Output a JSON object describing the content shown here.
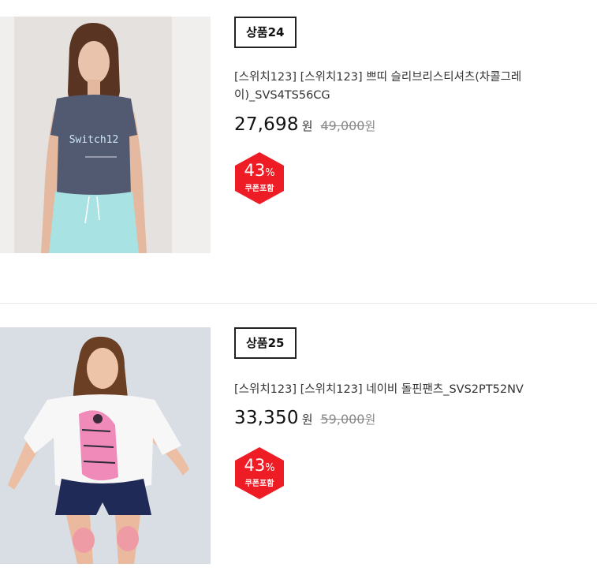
{
  "products": [
    {
      "tag": "상품24",
      "name": "[스위치123] [스위치123] 쁘띠 슬리브리스티셔츠(차콜그레이)_SVS4TS56CG",
      "price": "27,698",
      "price_unit": "원",
      "original_price": "49,000",
      "original_unit": "원",
      "discount_value": "43",
      "discount_unit": "%",
      "coupon_label": "쿠폰포함",
      "shirt_text": "Switch12",
      "badge_color": "#ee1c25"
    },
    {
      "tag": "상품25",
      "name": "[스위치123] [스위치123] 네이비 돌핀팬츠_SVS2PT52NV",
      "price": "33,350",
      "price_unit": "원",
      "original_price": "59,000",
      "original_unit": "원",
      "discount_value": "43",
      "discount_unit": "%",
      "coupon_label": "쿠폰포함",
      "badge_color": "#ee1c25"
    }
  ]
}
